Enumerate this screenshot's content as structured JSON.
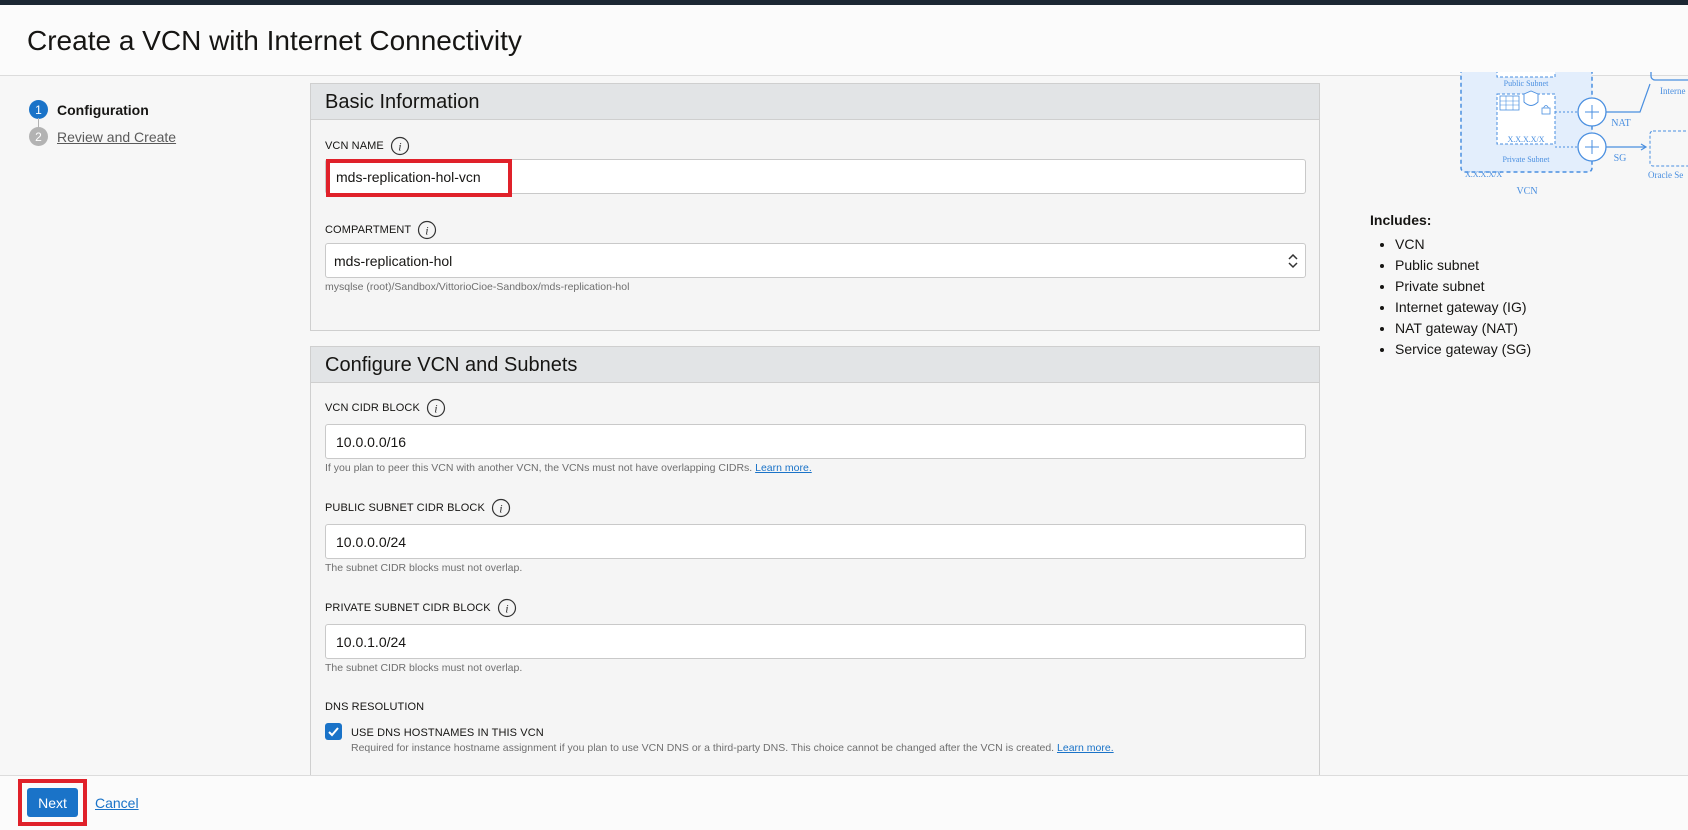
{
  "header": {
    "title": "Create a VCN with Internet Connectivity"
  },
  "steps": [
    {
      "number": "1",
      "label": "Configuration"
    },
    {
      "number": "2",
      "label": "Review and Create"
    }
  ],
  "basic": {
    "title": "Basic Information",
    "vcn_name": {
      "label": "VCN NAME",
      "value": "mds-replication-hol-vcn"
    },
    "compartment": {
      "label": "COMPARTMENT",
      "value": "mds-replication-hol",
      "path": "mysqlse (root)/Sandbox/VittorioCioe-Sandbox/mds-replication-hol"
    }
  },
  "configure": {
    "title": "Configure VCN and Subnets",
    "vcn_cidr": {
      "label": "VCN CIDR BLOCK",
      "value": "10.0.0.0/16",
      "help": "If you plan to peer this VCN with another VCN, the VCNs must not have overlapping CIDRs.",
      "help_link": "Learn more."
    },
    "public_cidr": {
      "label": "PUBLIC SUBNET CIDR BLOCK",
      "value": "10.0.0.0/24",
      "help": "The subnet CIDR blocks must not overlap."
    },
    "private_cidr": {
      "label": "PRIVATE SUBNET CIDR BLOCK",
      "value": "10.0.1.0/24",
      "help": "The subnet CIDR blocks must not overlap."
    },
    "dns": {
      "label": "DNS RESOLUTION",
      "checkbox_label": "USE DNS HOSTNAMES IN THIS VCN",
      "help": "Required for instance hostname assignment if you plan to use VCN DNS or a third-party DNS. This choice cannot be changed after the VCN is created.",
      "help_link": "Learn more.",
      "checked": true
    }
  },
  "diagram": {
    "public_subnet": "Public Subnet",
    "private_subnet": "Private Subnet",
    "cidr_text": "X.X.X.X/X",
    "vcn_cidr_text": "X.X.X.X/X",
    "vcn": "VCN",
    "nat": "NAT",
    "sg": "SG",
    "internet": "Interne",
    "oracle": "Oracle Se",
    "colors": {
      "accent": "#4a8fe0",
      "fill": "#e3eefc"
    }
  },
  "includes": {
    "title": "Includes:",
    "items": [
      "VCN",
      "Public subnet",
      "Private subnet",
      "Internet gateway (IG)",
      "NAT gateway (NAT)",
      "Service gateway (SG)"
    ]
  },
  "footer": {
    "next": "Next",
    "cancel": "Cancel"
  }
}
